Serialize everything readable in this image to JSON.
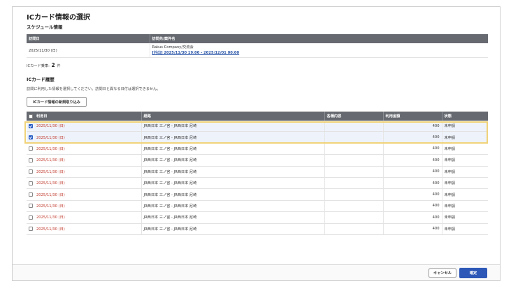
{
  "page_title": "ICカード情報の選択",
  "schedule": {
    "section_title": "スケジュール情報",
    "headers": [
      "訪問日",
      "訪問先/案件名"
    ],
    "visit_date": "2025/11/30 (日)",
    "destination": "Rakus Company/交流会",
    "event_link": "[外出] 2025/11/30 19:00 - 2025/12/01 00:00"
  },
  "card_count": {
    "label": "ICカード乗車:",
    "value": "2",
    "unit": "件"
  },
  "history": {
    "section_title": "ICカード履歴",
    "note": "訪問に利用した情報を選択してください。訪問日と異なる日付は選択できません。",
    "import_button": "ICカード情報の新規取り込み",
    "headers": [
      "利用日",
      "経路",
      "各種内容",
      "利用金額",
      "状態"
    ],
    "rows": [
      {
        "date": "2025/11/30 (日)",
        "route": "JR西日本 三ノ宮 - JR西日本 尼崎",
        "details": "",
        "amount": "400",
        "status": "未申請",
        "checked": true
      },
      {
        "date": "2025/11/30 (日)",
        "route": "JR西日本 三ノ宮 - JR西日本 尼崎",
        "details": "",
        "amount": "400",
        "status": "未申請",
        "checked": true
      },
      {
        "date": "2025/11/30 (日)",
        "route": "JR西日本 三ノ宮 - JR西日本 尼崎",
        "details": "",
        "amount": "400",
        "status": "未申請",
        "checked": false
      },
      {
        "date": "2025/11/30 (日)",
        "route": "JR西日本 三ノ宮 - JR西日本 尼崎",
        "details": "",
        "amount": "400",
        "status": "未申請",
        "checked": false
      },
      {
        "date": "2025/11/30 (日)",
        "route": "JR西日本 三ノ宮 - JR西日本 尼崎",
        "details": "",
        "amount": "400",
        "status": "未申請",
        "checked": false
      },
      {
        "date": "2025/11/30 (日)",
        "route": "JR西日本 三ノ宮 - JR西日本 尼崎",
        "details": "",
        "amount": "400",
        "status": "未申請",
        "checked": false
      },
      {
        "date": "2025/11/30 (日)",
        "route": "JR西日本 三ノ宮 - JR西日本 尼崎",
        "details": "",
        "amount": "400",
        "status": "未申請",
        "checked": false
      },
      {
        "date": "2025/11/30 (日)",
        "route": "JR西日本 三ノ宮 - JR西日本 尼崎",
        "details": "",
        "amount": "400",
        "status": "未申請",
        "checked": false
      },
      {
        "date": "2025/11/30 (日)",
        "route": "JR西日本 三ノ宮 - JR西日本 尼崎",
        "details": "",
        "amount": "400",
        "status": "未申請",
        "checked": false
      },
      {
        "date": "2025/11/30 (日)",
        "route": "JR西日本 三ノ宮 - JR西日本 尼崎",
        "details": "",
        "amount": "400",
        "status": "未申請",
        "checked": false
      }
    ]
  },
  "footer": {
    "cancel_label": "キャンセル",
    "ok_label": "確定"
  },
  "colors": {
    "accent": "#2e58b7",
    "header_bg": "#666a70",
    "date_text": "#c0392b",
    "highlight": "#f0d37a"
  }
}
